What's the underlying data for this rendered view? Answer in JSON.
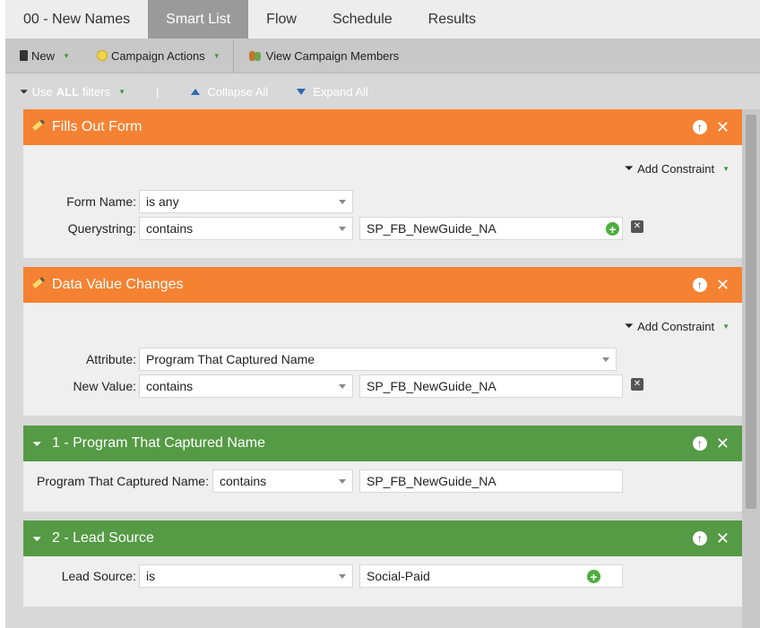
{
  "tabs": [
    {
      "label": "00 - New Names"
    },
    {
      "label": "Smart List"
    },
    {
      "label": "Flow"
    },
    {
      "label": "Schedule"
    },
    {
      "label": "Results"
    }
  ],
  "toolbar": {
    "new_label": "New",
    "campaign_actions_label": "Campaign Actions",
    "view_members_label": "View Campaign Members"
  },
  "filterbar": {
    "use_prefix": "Use ",
    "use_bold": "ALL",
    "use_suffix": " filters",
    "divider": "|",
    "collapse_label": "Collapse All",
    "expand_label": "Expand All"
  },
  "add_constraint_label": "Add Constraint",
  "filters": [
    {
      "title": "Fills Out Form",
      "rows": [
        {
          "label": "Form Name:",
          "operator": "is any"
        },
        {
          "label": "Querystring:",
          "operator": "contains",
          "value": "SP_FB_NewGuide_NA"
        }
      ]
    },
    {
      "title": "Data Value Changes",
      "rows": [
        {
          "label": "Attribute:",
          "operator": "Program That Captured Name"
        },
        {
          "label": "New Value:",
          "operator": "contains",
          "value": "SP_FB_NewGuide_NA"
        }
      ]
    },
    {
      "title": "1 - Program That Captured Name",
      "rows": [
        {
          "label": "Program That Captured Name:",
          "operator": "contains",
          "value": "SP_FB_NewGuide_NA"
        }
      ]
    },
    {
      "title": "2 - Lead Source",
      "rows": [
        {
          "label": "Lead Source:",
          "operator": "is",
          "value": "Social-Paid"
        }
      ]
    }
  ],
  "colors": {
    "trigger_header": "#f58232",
    "filter_header": "#559a45",
    "active_tab": "#9a9a9a"
  }
}
